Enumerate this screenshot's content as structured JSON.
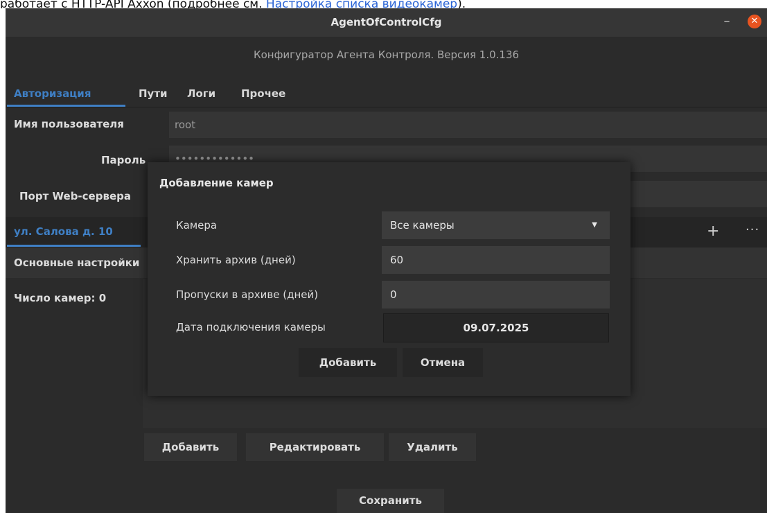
{
  "doc": {
    "text_before": "работает с HTTP-API Axxon (подробнее см. ",
    "link_text": "Настройка списка видеокамер",
    "text_after": ")."
  },
  "window": {
    "title": "AgentOfControlCfg",
    "minimize_glyph": "–",
    "close_glyph": "✕",
    "subtitle": "Конфигуратор Агента Контроля. Версия 1.0.136"
  },
  "tabs": [
    "Авторизация",
    "Пути",
    "Логи",
    "Прочее"
  ],
  "auth": {
    "username_label": "Имя пользователя",
    "username_value": "root",
    "password_label": "Пароль",
    "password_value": "•••••••••••••",
    "port_label": "Порт Web-сервера"
  },
  "site": {
    "address": "ул. Салова д. 10",
    "add_glyph": "+",
    "more_glyph": "···",
    "settings_label": "Основные настройки",
    "camera_count": "Число камер: 0"
  },
  "actions": {
    "add": "Добавить",
    "edit": "Редактировать",
    "delete": "Удалить",
    "save": "Сохранить"
  },
  "dialog": {
    "title": "Добавление камер",
    "camera_label": "Камера",
    "camera_value": "Все камеры",
    "archive_days_label": "Хранить архив (дней)",
    "archive_days_value": "60",
    "gaps_label": "Пропуски в архиве (дней)",
    "gaps_value": "0",
    "date_label": "Дата подключения камеры",
    "date_value": "09.07.2025",
    "ok": "Добавить",
    "cancel": "Отмена"
  },
  "colors": {
    "accent": "#3f7fc4",
    "close": "#e95420",
    "window_bg": "#2b2b2b",
    "link": "#2a64d6"
  }
}
